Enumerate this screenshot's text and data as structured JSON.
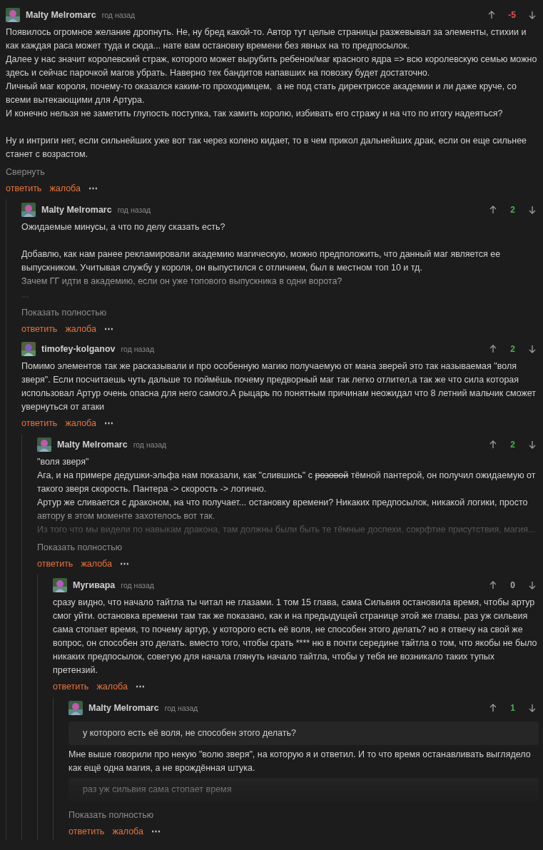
{
  "comments": [
    {
      "author": "Malty Melromarc",
      "time": "год назад",
      "score": "-5",
      "color": "#e05555",
      "collapsed": false,
      "expand_link": "Свернуть",
      "actions": [
        "ответить",
        "жалоба",
        "⋯"
      ],
      "body": [
        {
          "kind": "text",
          "text": "Появилось огромное желание дропнуть. Не, ну бред какой-то. Автор тут целые страницы разжевывал за элементы, стихии и как каждая раса может туда и сюда... нате вам остановку времени без явных на то предпосылок."
        },
        {
          "kind": "text",
          "text": "Далее у нас значит королевский страж, которого может вырубить ребенок/маг красного ядра => всю королевскую семью можно здесь и сейчас парочкой магов убрать. Наверно тех бандитов напавших на повозку будет достаточно."
        },
        {
          "kind": "text",
          "text": "Личный маг короля, почему-то оказался каким-то проходимцем,  а не под стать директриссе академии и ли даже круче, со всеми вытекающими для Артура."
        },
        {
          "kind": "text",
          "text": "И конечно нельзя не заметить глупость поступка, так хамить королю, избивать его стражу и на что по итогу надеяться?"
        },
        {
          "kind": "gap"
        },
        {
          "kind": "text",
          "text": "Ну и интриги нет, если сильнейших уже вот так через колено кидает, то в чем прикол дальнейших драк, если он еще сильнее станет с возрастом."
        }
      ],
      "children": [
        {
          "author": "Malty Melromarc",
          "time": "год назад",
          "score": "2",
          "color": "#4caf50",
          "collapsed": true,
          "expand_link": "Показать полностью",
          "actions": [
            "ответить",
            "жалоба",
            "⋯"
          ],
          "body": [
            {
              "kind": "text",
              "text": "Ожидаемые минусы, а что по делу сказать есть?"
            },
            {
              "kind": "gap"
            },
            {
              "kind": "text",
              "text": "Добавлю, как нам ранее рекламировали академию магическую, можно предположить, что данный маг является ее выпускником. Учитывая службу у короля, он выпустился с отличием, был в местном топ 10 и тд."
            },
            {
              "kind": "text",
              "text": "Зачем ГГ идти в академию, если он уже топового выпускника в одни ворота?"
            },
            {
              "kind": "text",
              "text": "..."
            }
          ]
        },
        {
          "author": "timofey-kolganov",
          "time": "год назад",
          "score": "2",
          "color": "#4caf50",
          "collapsed": false,
          "actions": [
            "ответить",
            "жалоба",
            "⋯"
          ],
          "body": [
            {
              "kind": "text",
              "text": "Помимо элементов так же расказывали и про особенную магию получаемую от мана зверей это так называемая \"воля зверя\". Если посчитаешь чуть дальше то поймёшь почему предворный маг так легко отлител,а так же что сила которая использовал Артур очень опасна для него самого.А рыцарь по понятным причинам неожидал что 8 летний мальчик сможет увернуться от атаки"
            }
          ],
          "children": [
            {
              "author": "Malty Melromarc",
              "time": "год назад",
              "score": "2",
              "color": "#4caf50",
              "collapsed": true,
              "expand_link": "Показать полностью",
              "actions": [
                "ответить",
                "жалоба",
                "⋯"
              ],
              "body": [
                {
                  "kind": "text",
                  "text": "\"воля зверя\""
                },
                {
                  "kind": "parts",
                  "parts": [
                    {
                      "text": "Ага, и на примере дедушки-эльфа нам показали, как \"слившись\" с ",
                      "strike": false
                    },
                    {
                      "text": "розовой",
                      "strike": true
                    },
                    {
                      "text": " тёмной пантерой, он получил ожидаемую от такого зверя скорость. Пантера -> скорость -> логично.",
                      "strike": false
                    }
                  ]
                },
                {
                  "kind": "text",
                  "text": "Артур же сливается с драконом, на что получает... остановку времени? Никаких предпосылок, никакой логики, просто автору в этом моменте захотелось вот так."
                },
                {
                  "kind": "text",
                  "text": "Из того что мы видели по навыкам дракона, там должны были быть те тёмные доспехи, сокрфтие присутствия, магия..."
                }
              ],
              "children": [
                {
                  "author": "Мугивара",
                  "time": "год назад",
                  "score": "0",
                  "color": "#aaaaaa",
                  "collapsed": false,
                  "actions": [
                    "ответить",
                    "жалоба",
                    "⋯"
                  ],
                  "body": [
                    {
                      "kind": "text",
                      "text": "сразу видно, что начало тайтла ты читал не глазами. 1 том 15 глава, сама Сильвия остановила время, чтобы артур смог уйти. остановка времени там так же показано, как и на предыдущей странице этой же главы. раз уж сильвия сама стопает время, то почему артур, у которого есть её воля, не способен этого делать? но я отвечу на свой же вопрос, он способен это делать. вместо того, чтобы срать **** ню в почти середине тайтла о том, что якобы не было никаких предпосылок, советую для начала глянуть начало тайтла, чтобы у тебя не возникало таких тупых претензий."
                    }
                  ],
                  "children": [
                    {
                      "author": "Malty Melromarc",
                      "time": "год назад",
                      "score": "1",
                      "color": "#4caf50",
                      "collapsed": true,
                      "expand_link": "Показать полностью",
                      "actions": [
                        "ответить",
                        "жалоба",
                        "⋯"
                      ],
                      "body": [
                        {
                          "kind": "quote",
                          "text": "у которого есть её воля, не способен этого делать?"
                        },
                        {
                          "kind": "text",
                          "text": "Мне выше говорили про некую \"волю зверя\", на которую я и ответил. И то что время останавливать выглядело как ещё одна магия, а не врождённая штука."
                        },
                        {
                          "kind": "quote",
                          "text": "раз уж сильвия сама стопает время"
                        }
                      ]
                    }
                  ]
                }
              ]
            }
          ]
        }
      ]
    }
  ]
}
